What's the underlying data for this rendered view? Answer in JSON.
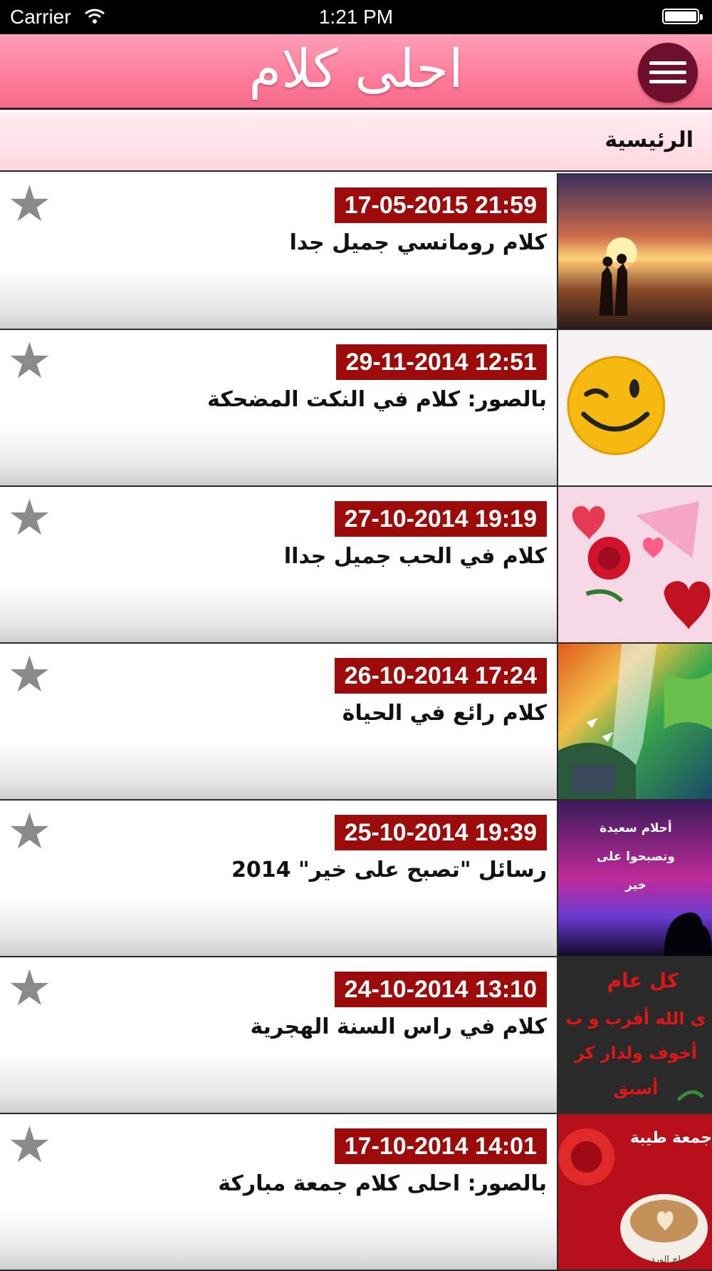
{
  "status_bar": {
    "carrier": "Carrier",
    "time": "1:21 PM",
    "battery_level": 1.0
  },
  "header": {
    "app_title": "احلى كلام",
    "menu_icon": "menu-icon"
  },
  "breadcrumb": {
    "label": "الرئيسية"
  },
  "articles": [
    {
      "date": "17-05-2015 21:59",
      "title": "كلام رومانسي جميل جدا",
      "thumb": "sunset-couple",
      "favorite_icon": "star-icon"
    },
    {
      "date": "29-11-2014 12:51",
      "title": "بالصور: كلام في النكت المضحكة",
      "thumb": "winking-smiley",
      "favorite_icon": "star-icon"
    },
    {
      "date": "27-10-2014 19:19",
      "title": "كلام في الحب جميل جداا",
      "thumb": "hearts-rose",
      "favorite_icon": "star-icon"
    },
    {
      "date": "26-10-2014 17:24",
      "title": "كلام رائع في الحياة",
      "thumb": "fantasy-landscape",
      "favorite_icon": "star-icon"
    },
    {
      "date": "25-10-2014 19:39",
      "title": "رسائل \"تصبح على خير\"  2014",
      "thumb": "night-sky-text",
      "thumb_text": [
        "أحلام سعيدة",
        "وتصبحوا على",
        "خير"
      ],
      "favorite_icon": "star-icon"
    },
    {
      "date": "24-10-2014 13:10",
      "title": "كلام في راس السنة الهجرية",
      "thumb": "new-year-text",
      "thumb_text": [
        "كل عام",
        "ى الله أقرب و ب",
        "أخوف ولدار كر",
        "أسبق"
      ],
      "favorite_icon": "star-icon"
    },
    {
      "date": "17-10-2014 14:01",
      "title": "بالصور: احلى كلام جمعة مباركة",
      "thumb": "coffee-rose",
      "thumb_text": [
        "جمعة طيبة",
        "صباح الورد"
      ],
      "favorite_icon": "star-icon"
    }
  ],
  "colors": {
    "header_pink": "#ff7f9d",
    "menu_button": "#6e0f2b",
    "date_badge": "#9c0a0a",
    "star": "#8a8a8a"
  }
}
